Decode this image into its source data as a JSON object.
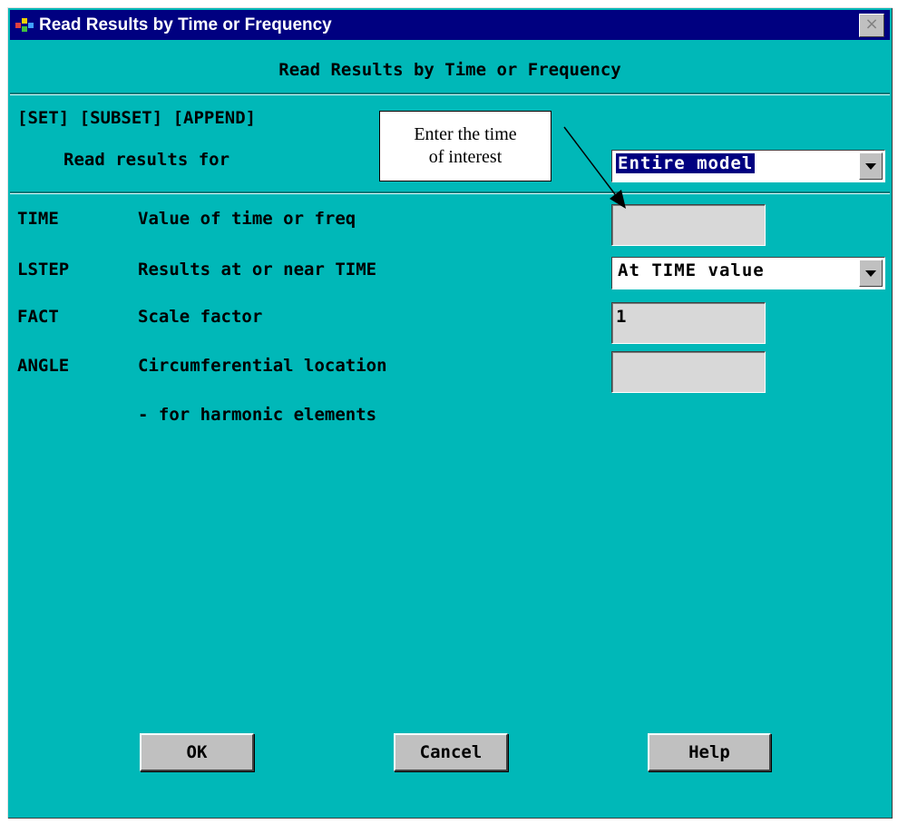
{
  "window": {
    "title": "Read Results by Time or Frequency",
    "close_label": "×",
    "header": "Read Results by Time or Frequency"
  },
  "section": {
    "command": "[SET] [SUBSET] [APPEND]",
    "read_label": "Read results for",
    "read_value": "Entire model"
  },
  "rows": [
    {
      "key": "TIME",
      "label": "Value of time or freq",
      "value": ""
    },
    {
      "key": "LSTEP",
      "label": "Results at or near TIME",
      "value": "At TIME value"
    },
    {
      "key": "FACT",
      "label": "Scale factor",
      "value": "1"
    },
    {
      "key": "ANGLE",
      "label": "Circumferential location",
      "value": ""
    }
  ],
  "note": "- for harmonic elements",
  "callout": {
    "line1": "Enter the time",
    "line2": "of interest"
  },
  "buttons": {
    "ok": "OK",
    "cancel": "Cancel",
    "help": "Help"
  },
  "colors": {
    "dialog_bg": "#00b8b8",
    "titlebar": "#000080",
    "field_bg": "#d8d8d8"
  },
  "icons": {
    "app": "ansys-app-icon",
    "close": "close-icon",
    "dropdown": "dropdown-arrow-icon"
  }
}
